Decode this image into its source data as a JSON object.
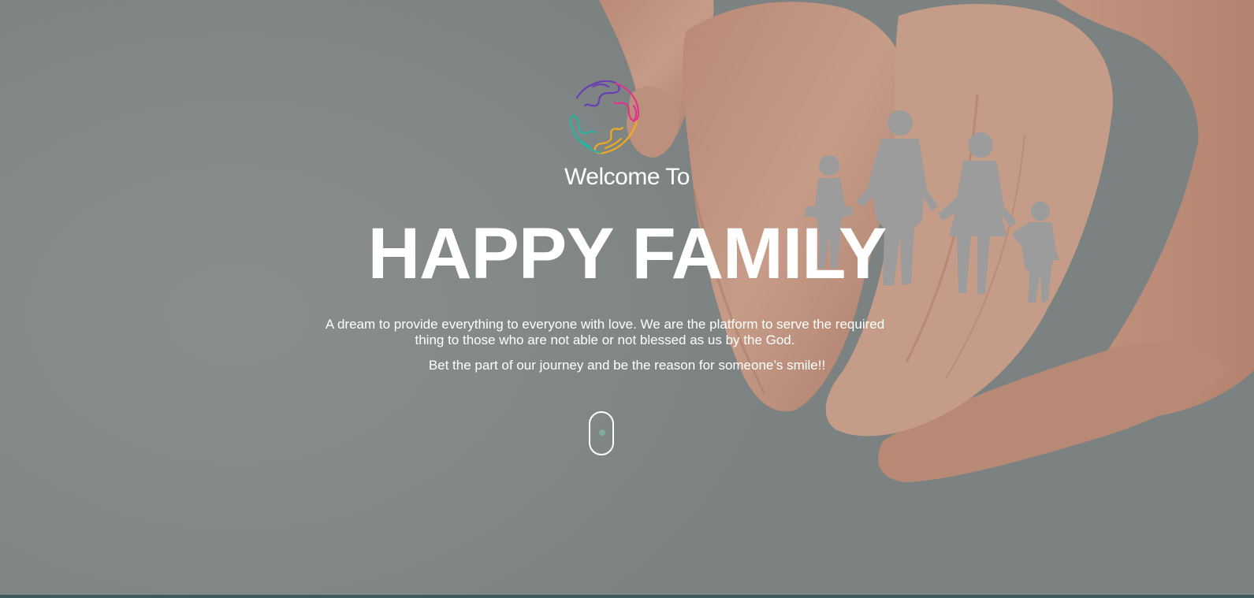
{
  "hero": {
    "welcome": "Welcome To",
    "title": "HAPPY FAMILY",
    "description": "A dream to provide everything to everyone with love. We are the platform to serve the required thing to those who are not able or not blessed as us by the God.",
    "tagline": "Bet the part of our journey and be the reason for someone’s smile!!"
  },
  "logo": {
    "icon": "hands-circle-logo-icon",
    "colors": [
      "#6a3fb5",
      "#e0338a",
      "#f2a91c",
      "#2bb3a3"
    ]
  },
  "scroll_indicator": {
    "icon": "mouse-scroll-icon",
    "dot_color": "#7fae9f"
  },
  "colors": {
    "background": "#868c8b",
    "skin": "#d8a48c",
    "paper_figures": "#a4a4a4",
    "bottom_accent": "#3d5a5e"
  }
}
